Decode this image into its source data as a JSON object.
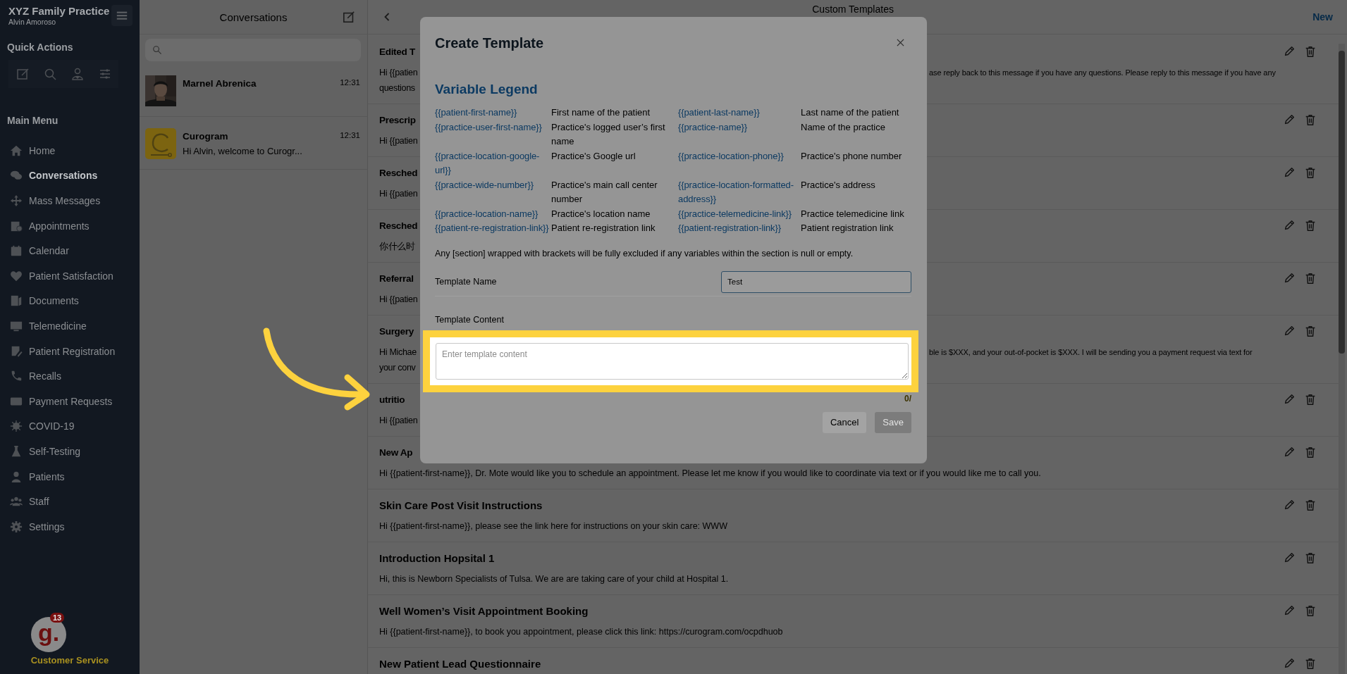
{
  "sidebar": {
    "practice": "XYZ Family Practice",
    "user": "Alvin Amoroso",
    "quick_actions_title": "Quick Actions",
    "main_menu_title": "Main Menu",
    "items": [
      {
        "label": "Home",
        "selected": false
      },
      {
        "label": "Conversations",
        "selected": true
      },
      {
        "label": "Mass Messages",
        "selected": false
      },
      {
        "label": "Appointments",
        "selected": false
      },
      {
        "label": "Calendar",
        "selected": false
      },
      {
        "label": "Patient Satisfaction",
        "selected": false
      },
      {
        "label": "Documents",
        "selected": false
      },
      {
        "label": "Telemedicine",
        "selected": false
      },
      {
        "label": "Patient Registration",
        "selected": false
      },
      {
        "label": "Recalls",
        "selected": false
      },
      {
        "label": "Payment Requests",
        "selected": false
      },
      {
        "label": "COVID-19",
        "selected": false
      },
      {
        "label": "Self-Testing",
        "selected": false
      },
      {
        "label": "Patients",
        "selected": false
      },
      {
        "label": "Staff",
        "selected": false
      },
      {
        "label": "Settings",
        "selected": false
      }
    ],
    "support": {
      "logo": "g.",
      "badge": "13",
      "label": "Customer Service"
    }
  },
  "conversations": {
    "title": "Conversations",
    "items": [
      {
        "name": "Marnel Abrenica",
        "time": "12:31"
      },
      {
        "kind": "logo",
        "name": "Curogram",
        "preview": "Hi Alvin, welcome to Curogr...",
        "time": "12:31"
      }
    ]
  },
  "templates": {
    "title": "Custom Templates",
    "new_label": "New",
    "rows": [
      {
        "kind": "covered",
        "title": "Edited T",
        "body": [
          "Hi {{patien",
          "questions"
        ],
        "body_right": [
          "ase reply back to this message if you have any questions. Please reply to this message if you have any"
        ]
      },
      {
        "kind": "covered",
        "title": "Prescrip",
        "body": [
          "Hi {{patien"
        ]
      },
      {
        "kind": "covered",
        "title": "Resched",
        "body": [
          "Hi {{patien"
        ]
      },
      {
        "kind": "covered",
        "title": "Resched",
        "body": [
          "你什么时"
        ]
      },
      {
        "kind": "covered",
        "title": "Referral",
        "body": [
          "Hi {{patien"
        ]
      },
      {
        "kind": "covered",
        "title": "Surgery",
        "body": [
          "Hi Michae",
          "your conv"
        ],
        "body_right": [
          "ble is $XXX, and your out-of-pocket is $XXX. I will be sending you a payment request via text for"
        ]
      },
      {
        "kind": "covered",
        "title": "utritio",
        "body": [
          "Hi {{patien"
        ]
      },
      {
        "kind": "title_covered",
        "title": "New Ap",
        "body": [
          "Hi {{patient-first-name}}, Dr. Mote would like you to schedule an appointment. Please let me know if you would like to coordinate via text or if you would like me to call you."
        ]
      },
      {
        "kind": "full",
        "title": "Skin Care Post Visit Instructions",
        "body": [
          "Hi {{patient-first-name}}, please see the link here for instructions on your skin care: WWW"
        ]
      },
      {
        "kind": "full",
        "title": "Introduction Hopsital 1",
        "body": [
          "Hi, this is Newborn Specialists of Tulsa. We are are taking care of your child at Hospital 1."
        ]
      },
      {
        "kind": "full",
        "title": "Well Women’s Visit Appointment Booking",
        "body": [
          "Hi {{patient-first-name}}, to book you appointment, please click this link: https://curogram.com/ocpdhuob"
        ]
      },
      {
        "kind": "full",
        "title": "New Patient Lead Questionnaire"
      }
    ]
  },
  "modal": {
    "title": "Create Template",
    "legend_title": "Variable Legend",
    "legend": [
      {
        "variable": "{{patient-first-name}}",
        "description": "First name of the patient"
      },
      {
        "variable": "{{patient-last-name}}",
        "description": "Last name of the patient"
      },
      {
        "variable": "{{practice-user-first-name}}",
        "description": "Practice's logged user’s first name"
      },
      {
        "variable": "{{practice-name}}",
        "description": "Name of the practice"
      },
      {
        "variable": "{{practice-location-google-url}}",
        "description": "Practice's Google url"
      },
      {
        "variable": "{{practice-location-phone}}",
        "description": "Practice's phone number"
      },
      {
        "variable": "{{practice-wide-number}}",
        "description": "Practice's main call center number"
      },
      {
        "variable": "{{practice-location-formatted-address}}",
        "description": "Practice's address"
      },
      {
        "variable": "{{practice-location-name}}",
        "description": "Practice's location name"
      },
      {
        "variable": "{{practice-telemedicine-link}}",
        "description": "Practice telemedicine link"
      },
      {
        "variable": "{{patient-re-registration-link}}",
        "description": "Patient re-registration link"
      },
      {
        "variable": "{{patient-registration-link}}",
        "description": "Patient registration link"
      }
    ],
    "note": "Any [section] wrapped with brackets will be fully excluded if any variables within the section is null or empty.",
    "name_label": "Template Name",
    "name_value": "Test",
    "content_label": "Template Content",
    "content_placeholder": "Enter template content",
    "counter": "0/",
    "buttons": [
      {
        "label": "Cancel",
        "disabled": false
      },
      {
        "label": "Save",
        "disabled": true
      }
    ]
  }
}
